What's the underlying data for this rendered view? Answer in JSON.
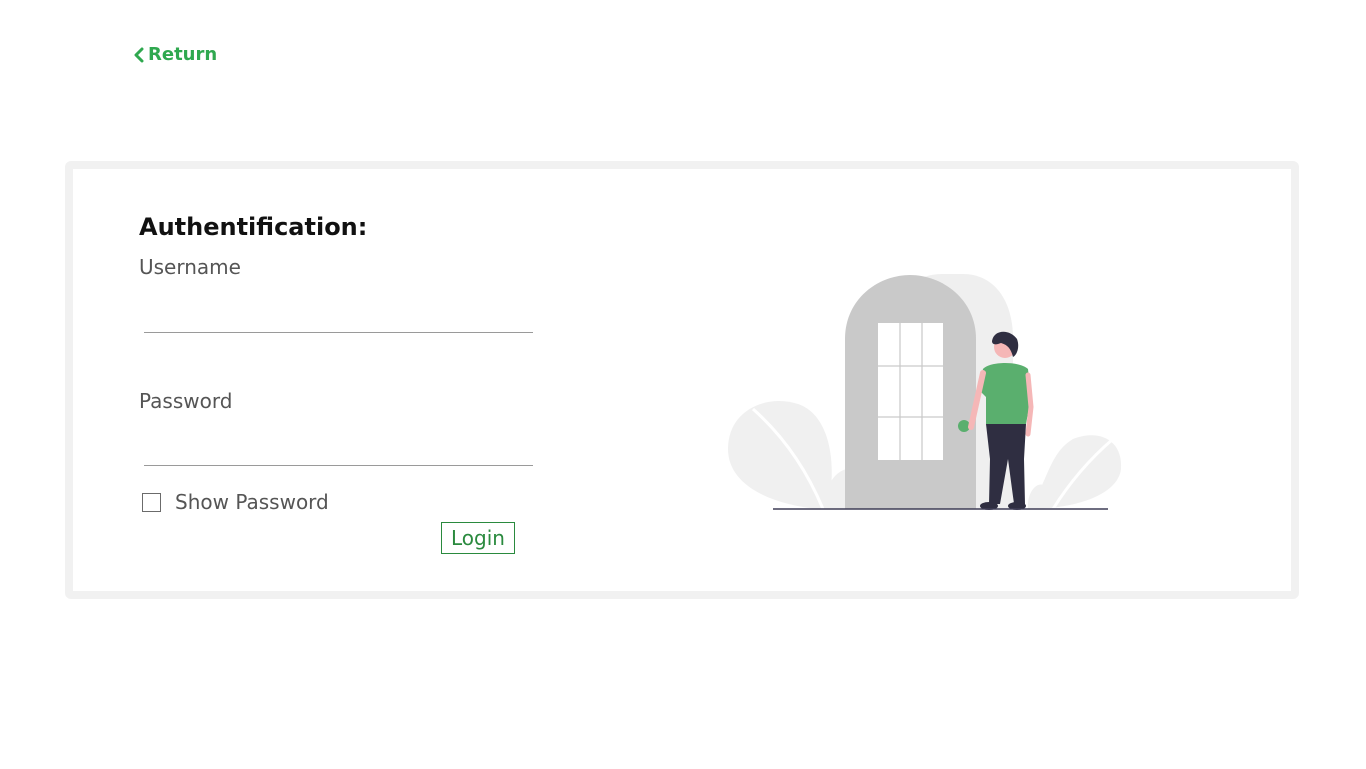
{
  "nav": {
    "return_label": "Return"
  },
  "auth": {
    "title": "Authentification:",
    "username_label": "Username",
    "username_value": "",
    "password_label": "Password",
    "password_value": "",
    "show_password_label": "Show Password",
    "show_password_checked": false,
    "login_label": "Login"
  },
  "colors": {
    "accent": "#2fa84f",
    "button": "#2a8a3e",
    "card_border": "#f1f1f1",
    "shirt": "#5aaf6e",
    "door": "#c9c9c9",
    "pants": "#2f2e41"
  },
  "icons": {
    "return": "chevron-left-icon",
    "illustration": "person-at-door-illustration"
  }
}
